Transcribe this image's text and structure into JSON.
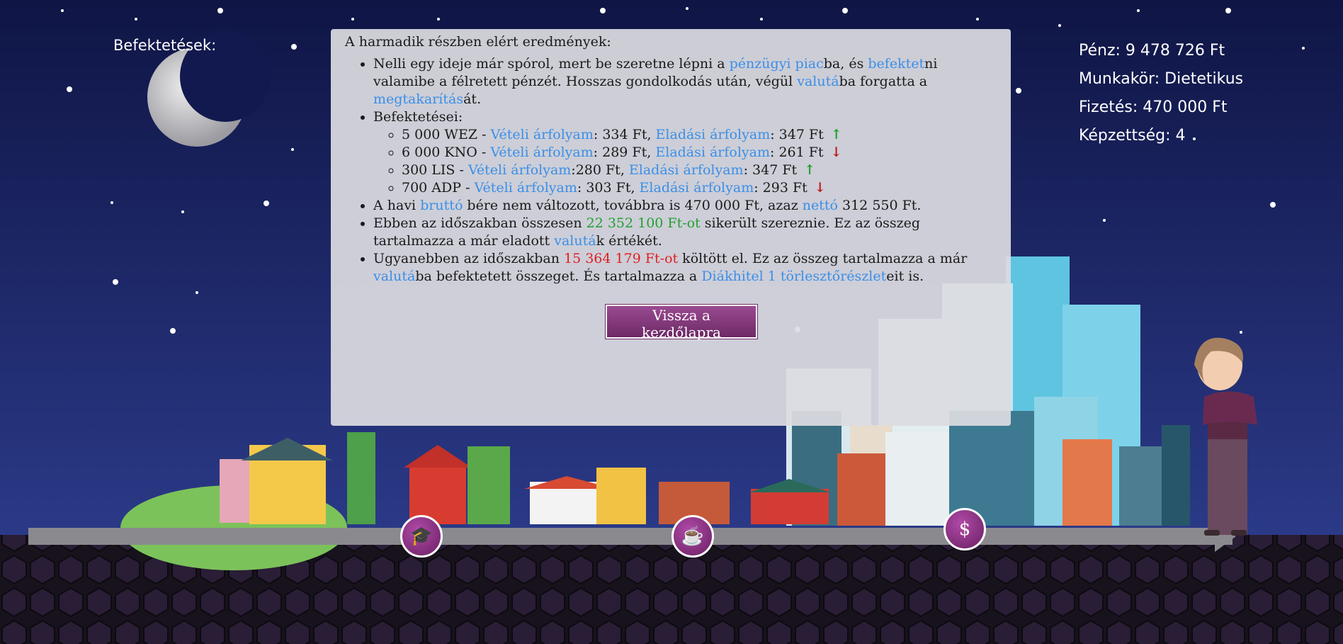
{
  "header": {
    "investments_label": "Befektetések:"
  },
  "stats": {
    "money": "Pénz: 9 478 726 Ft",
    "job": "Munkakör: Dietetikus",
    "salary": "Fizetés: 470 000 Ft",
    "education": "Képzettség: 4"
  },
  "panel": {
    "title": "A harmadik részben elért eredmények:",
    "p1": {
      "t1": "Nelli egy ideje már spórol, mert be szeretne lépni a ",
      "l1": "pénzügyi piac",
      "t2": "ba, és ",
      "l2": "befektet",
      "t3": "ni valamibe a félretett pénzét. Hosszas gondolkodás után, végül ",
      "l3": "valutá",
      "t4": "ba forgatta a ",
      "l4": "megtakarítás",
      "t5": "át."
    },
    "investments_heading": "Befektetései:",
    "buy_label": "Vételi árfolyam",
    "sell_label": "Eladási árfolyam",
    "investments": [
      {
        "amount": "5 000 WEZ - ",
        "buy": ": 334 Ft, ",
        "sell": ": 347 Ft",
        "trend": "up"
      },
      {
        "amount": "6 000 KNO - ",
        "buy": ": 289 Ft, ",
        "sell": ": 261 Ft",
        "trend": "down"
      },
      {
        "amount": "300 LIS - ",
        "buy": ":280 Ft, ",
        "sell": ": 347 Ft",
        "trend": "up"
      },
      {
        "amount": "700 ADP - ",
        "buy": ": 303 Ft, ",
        "sell": ": 293 Ft",
        "trend": "down"
      }
    ],
    "p3": {
      "t1": "A havi ",
      "l1": "bruttó",
      "t2": " bére nem változott, továbbra is 470 000 Ft, azaz ",
      "l2": "nettó",
      "t3": " 312 550 Ft."
    },
    "p4": {
      "t1": "Ebben az időszakban összesen ",
      "g1": "22 352 100 Ft-ot",
      "t2": " sikerült szereznie. Ez az összeg tartalmazza a már eladott ",
      "l1": "valutá",
      "t3": "k értékét."
    },
    "p5": {
      "t1": "Ugyanebben az időszakban ",
      "r1": "15 364 179 Ft-ot",
      "t2": " költött el. Ez az összeg tartalmazza a már ",
      "l1": "valutá",
      "t3": "ba befektetett összeget. És tartalmazza a ",
      "l2": "Diákhitel 1 törlesztőrészlet",
      "t4": "eit is."
    }
  },
  "button": {
    "label": "Vissza a kezdőlapra"
  },
  "icons": {
    "arrow_up": "↑",
    "arrow_down": "↓",
    "graduation": "🎓",
    "document_coffee": "☕",
    "coins": "$"
  },
  "colors": {
    "sky_top": "#0f1545",
    "sky_bottom": "#2a3580",
    "link": "#3a8fe8",
    "income_green": "#22a032",
    "spend_red": "#e02020",
    "accent_purple": "#7e3374"
  }
}
